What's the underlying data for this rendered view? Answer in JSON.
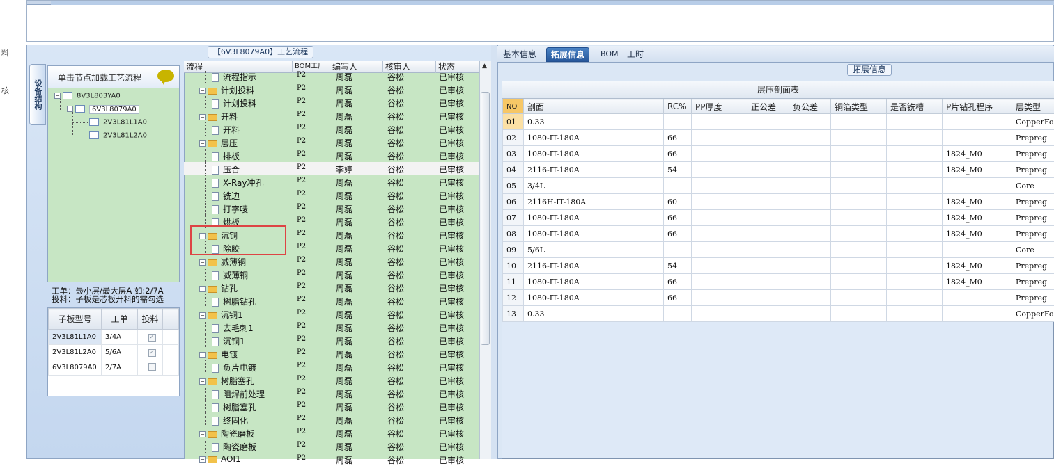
{
  "left_edge": {
    "chars": [
      "料",
      "核"
    ]
  },
  "flow_panel": {
    "title": "【6V3L8079A0】工艺流程"
  },
  "side_tab": {
    "label": "设备结构"
  },
  "tree": {
    "header": "单击节点加载工艺流程",
    "nodes": [
      "8V3L803YA0",
      "6V3L8079A0",
      "2V3L81L1A0",
      "2V3L81L2A0"
    ]
  },
  "note": {
    "line1": "工单：最小层/最大层A 如:2/7A",
    "line2": "投料：子板是芯板开料的需勾选"
  },
  "sub_table": {
    "columns": [
      "子板型号",
      "工单",
      "投料"
    ],
    "rows": [
      {
        "model": "2V3L81L1A0",
        "order": "3/4A",
        "feed": "✓"
      },
      {
        "model": "2V3L81L2A0",
        "order": "5/6A",
        "feed": "✓"
      },
      {
        "model": "6V3L8079A0",
        "order": "2/7A",
        "feed": ""
      }
    ]
  },
  "flow_table": {
    "columns": [
      "流程",
      "BOM工厂",
      "编写人",
      "核审人",
      "状态"
    ],
    "rows": [
      {
        "name": "流程指示",
        "plant": "P2",
        "writer": "周磊",
        "reviewer": "谷松",
        "status": "已审核",
        "kind": "doc"
      },
      {
        "name": "计划投料",
        "plant": "P2",
        "writer": "周磊",
        "reviewer": "谷松",
        "status": "已审核",
        "kind": "folder"
      },
      {
        "name": "计划投料",
        "plant": "P2",
        "writer": "周磊",
        "reviewer": "谷松",
        "status": "已审核",
        "kind": "doc"
      },
      {
        "name": "开料",
        "plant": "P2",
        "writer": "周磊",
        "reviewer": "谷松",
        "status": "已审核",
        "kind": "folder"
      },
      {
        "name": "开料",
        "plant": "P2",
        "writer": "周磊",
        "reviewer": "谷松",
        "status": "已审核",
        "kind": "doc"
      },
      {
        "name": "层压",
        "plant": "P2",
        "writer": "周磊",
        "reviewer": "谷松",
        "status": "已审核",
        "kind": "folder"
      },
      {
        "name": "排板",
        "plant": "P2",
        "writer": "周磊",
        "reviewer": "谷松",
        "status": "已审核",
        "kind": "doc"
      },
      {
        "name": "压合",
        "plant": "P2",
        "writer": "李婷",
        "reviewer": "谷松",
        "status": "已审核",
        "kind": "doc"
      },
      {
        "name": "X-Ray冲孔",
        "plant": "P2",
        "writer": "周磊",
        "reviewer": "谷松",
        "status": "已审核",
        "kind": "doc"
      },
      {
        "name": "铣边",
        "plant": "P2",
        "writer": "周磊",
        "reviewer": "谷松",
        "status": "已审核",
        "kind": "doc"
      },
      {
        "name": "打字唛",
        "plant": "P2",
        "writer": "周磊",
        "reviewer": "谷松",
        "status": "已审核",
        "kind": "doc"
      },
      {
        "name": "烘板",
        "plant": "P2",
        "writer": "周磊",
        "reviewer": "谷松",
        "status": "已审核",
        "kind": "doc"
      },
      {
        "name": "沉铜",
        "plant": "P2",
        "writer": "周磊",
        "reviewer": "谷松",
        "status": "已审核",
        "kind": "folder"
      },
      {
        "name": "除胶",
        "plant": "P2",
        "writer": "周磊",
        "reviewer": "谷松",
        "status": "已审核",
        "kind": "doc"
      },
      {
        "name": "减薄铜",
        "plant": "P2",
        "writer": "周磊",
        "reviewer": "谷松",
        "status": "已审核",
        "kind": "folder"
      },
      {
        "name": "减薄铜",
        "plant": "P2",
        "writer": "周磊",
        "reviewer": "谷松",
        "status": "已审核",
        "kind": "doc"
      },
      {
        "name": "钻孔",
        "plant": "P2",
        "writer": "周磊",
        "reviewer": "谷松",
        "status": "已审核",
        "kind": "folder"
      },
      {
        "name": "树脂钻孔",
        "plant": "P2",
        "writer": "周磊",
        "reviewer": "谷松",
        "status": "已审核",
        "kind": "doc"
      },
      {
        "name": "沉铜1",
        "plant": "P2",
        "writer": "周磊",
        "reviewer": "谷松",
        "status": "已审核",
        "kind": "folder"
      },
      {
        "name": "去毛刺1",
        "plant": "P2",
        "writer": "周磊",
        "reviewer": "谷松",
        "status": "已审核",
        "kind": "doc"
      },
      {
        "name": "沉铜1",
        "plant": "P2",
        "writer": "周磊",
        "reviewer": "谷松",
        "status": "已审核",
        "kind": "doc"
      },
      {
        "name": "电镀",
        "plant": "P2",
        "writer": "周磊",
        "reviewer": "谷松",
        "status": "已审核",
        "kind": "folder"
      },
      {
        "name": "负片电镀",
        "plant": "P2",
        "writer": "周磊",
        "reviewer": "谷松",
        "status": "已审核",
        "kind": "doc"
      },
      {
        "name": "树脂塞孔",
        "plant": "P2",
        "writer": "周磊",
        "reviewer": "谷松",
        "status": "已审核",
        "kind": "folder"
      },
      {
        "name": "阻焊前处理",
        "plant": "P2",
        "writer": "周磊",
        "reviewer": "谷松",
        "status": "已审核",
        "kind": "doc"
      },
      {
        "name": "树脂塞孔",
        "plant": "P2",
        "writer": "周磊",
        "reviewer": "谷松",
        "status": "已审核",
        "kind": "doc"
      },
      {
        "name": "终固化",
        "plant": "P2",
        "writer": "周磊",
        "reviewer": "谷松",
        "status": "已审核",
        "kind": "doc"
      },
      {
        "name": "陶瓷磨板",
        "plant": "P2",
        "writer": "周磊",
        "reviewer": "谷松",
        "status": "已审核",
        "kind": "folder"
      },
      {
        "name": "陶瓷磨板",
        "plant": "P2",
        "writer": "周磊",
        "reviewer": "谷松",
        "status": "已审核",
        "kind": "doc"
      },
      {
        "name": "AOI1",
        "plant": "P2",
        "writer": "周磊",
        "reviewer": "谷松",
        "status": "已审核",
        "kind": "folder"
      }
    ]
  },
  "right_tabs": [
    "基本信息",
    "拓展信息",
    "BOM",
    "工时"
  ],
  "right_active_tab": "拓展信息",
  "ext_panel": {
    "title": "拓展信息"
  },
  "stackup": {
    "title": "层压剖面表",
    "columns": [
      "NO",
      "剖面",
      "RC%",
      "PP厚度",
      "正公差",
      "负公差",
      "铜箔类型",
      "是否铣槽",
      "P片钻孔程序",
      "层类型"
    ],
    "rows": [
      [
        "01",
        "0.33",
        "",
        "",
        "",
        "",
        "",
        "",
        "",
        "CopperFo"
      ],
      [
        "02",
        "1080-IT-180A",
        "66",
        "",
        "",
        "",
        "",
        "",
        "",
        "Prepreg"
      ],
      [
        "03",
        "1080-IT-180A",
        "66",
        "",
        "",
        "",
        "",
        "",
        "1824_M0",
        "Prepreg"
      ],
      [
        "04",
        "2116-IT-180A",
        "54",
        "",
        "",
        "",
        "",
        "",
        "1824_M0",
        "Prepreg"
      ],
      [
        "05",
        "3/4L",
        "",
        "",
        "",
        "",
        "",
        "",
        "",
        "Core"
      ],
      [
        "06",
        "2116H-IT-180A",
        "60",
        "",
        "",
        "",
        "",
        "",
        "1824_M0",
        "Prepreg"
      ],
      [
        "07",
        "1080-IT-180A",
        "66",
        "",
        "",
        "",
        "",
        "",
        "1824_M0",
        "Prepreg"
      ],
      [
        "08",
        "1080-IT-180A",
        "66",
        "",
        "",
        "",
        "",
        "",
        "1824_M0",
        "Prepreg"
      ],
      [
        "09",
        "5/6L",
        "",
        "",
        "",
        "",
        "",
        "",
        "",
        "Core"
      ],
      [
        "10",
        "2116-IT-180A",
        "54",
        "",
        "",
        "",
        "",
        "",
        "1824_M0",
        "Prepreg"
      ],
      [
        "11",
        "1080-IT-180A",
        "66",
        "",
        "",
        "",
        "",
        "",
        "1824_M0",
        "Prepreg"
      ],
      [
        "12",
        "1080-IT-180A",
        "66",
        "",
        "",
        "",
        "",
        "",
        "",
        "Prepreg"
      ],
      [
        "13",
        "0.33",
        "",
        "",
        "",
        "",
        "",
        "",
        "",
        "CopperFo"
      ]
    ]
  },
  "colors": {
    "tree_bg": "#c7e6c4",
    "tab_active": "#26579a",
    "highlight_box": "#dd4444",
    "no_header": "#f7c766"
  }
}
